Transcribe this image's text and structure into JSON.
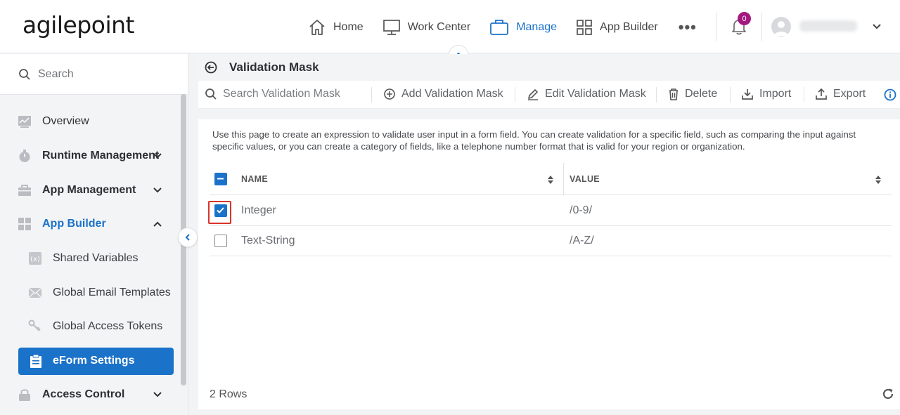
{
  "app": {
    "logo_text": "agilepoint"
  },
  "header": {
    "nav": [
      {
        "label": "Home",
        "icon": "home-icon"
      },
      {
        "label": "Work Center",
        "icon": "monitor-icon"
      },
      {
        "label": "Manage",
        "icon": "briefcase-icon",
        "active": true
      },
      {
        "label": "App Builder",
        "icon": "grid-icon"
      }
    ],
    "more_label": "•••",
    "notification_count": "0",
    "user_name": "xxxxxxxx",
    "accent_color": "#1b72c9",
    "badge_color": "#a3197f"
  },
  "sidebar": {
    "search_placeholder": "Search",
    "items": [
      {
        "label": "Overview",
        "icon": "chart-icon"
      },
      {
        "label": "Runtime Management",
        "icon": "stopwatch-icon",
        "expandable": true
      },
      {
        "label": "App Management",
        "icon": "toolbox-icon",
        "expandable": true
      },
      {
        "label": "App Builder",
        "icon": "apps-icon",
        "expanded": true
      },
      {
        "label": "Shared Variables",
        "icon": "variable-icon"
      },
      {
        "label": "Global Email Templates",
        "icon": "email-icon"
      },
      {
        "label": "Global Access Tokens",
        "icon": "keys-icon"
      },
      {
        "label": "eForm Settings",
        "icon": "clipboard-icon",
        "active": true
      },
      {
        "label": "Access Control",
        "icon": "lock-icon",
        "expandable": true
      }
    ]
  },
  "page": {
    "title": "Validation Mask",
    "toolbar": {
      "search_placeholder": "Search Validation Mask",
      "add": "Add Validation Mask",
      "edit": "Edit Validation Mask",
      "delete": "Delete",
      "import": "Import",
      "export": "Export"
    },
    "description": "Use this page to create an expression to validate user input in a form field. You can create validation for a specific field, such as comparing the input against specific values, or you can create a category of fields, like a telephone number format that is valid for your region or organization.",
    "table": {
      "columns": [
        "NAME",
        "VALUE"
      ],
      "rows": [
        {
          "name": "Integer",
          "value": "/0-9/",
          "checked": true
        },
        {
          "name": "Text-String",
          "value": "/A-Z/",
          "checked": false
        }
      ]
    },
    "row_count": "2 Rows"
  }
}
